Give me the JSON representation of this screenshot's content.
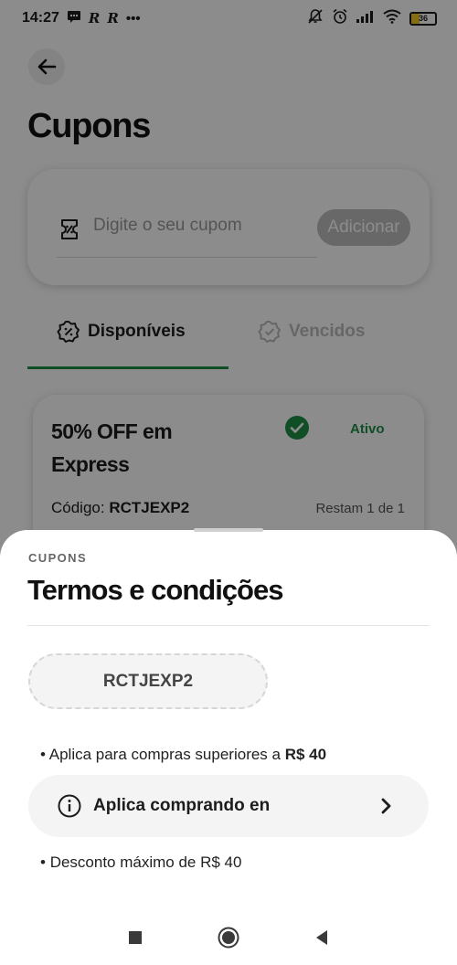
{
  "status_bar": {
    "time": "14:27",
    "left_icons": [
      "message-icon",
      "r-app-icon",
      "r-app-icon",
      "more-dots-icon"
    ],
    "right_icons": [
      "mute-icon",
      "alarm-icon",
      "signal-icon",
      "wifi-icon",
      "battery-icon"
    ],
    "battery_level": "36",
    "battery_fraction": 0.36
  },
  "header": {
    "back_icon": "arrow-left-icon",
    "title": "Cupons"
  },
  "coupon_input": {
    "icon": "coupon-ticket-icon",
    "placeholder": "Digite o seu cupom",
    "add_label": "Adicionar"
  },
  "tabs": [
    {
      "label": "Disponíveis",
      "icon": "badge-percent-icon",
      "selected": true
    },
    {
      "label": "Vencidos",
      "icon": "badge-check-icon",
      "selected": false
    }
  ],
  "coupon_card": {
    "title": "50% OFF em Express",
    "status": "Ativo",
    "status_icon": "check-circle-icon",
    "code_label": "Código:",
    "code": "RCTJEXP2",
    "remaining": "Restam 1 de 1"
  },
  "sheet": {
    "kicker": "CUPONS",
    "title": "Termos e condições",
    "code": "RCTJEXP2",
    "bullet_min_prefix": "Aplica para compras superiores a ",
    "bullet_min_value": "R$ 40",
    "apply_row": {
      "icon": "info-icon",
      "label": "Aplica comprando en",
      "chevron": "chevron-right-icon"
    },
    "bullet_max": "Desconto máximo de R$ 40"
  },
  "nav_bar": {
    "items": [
      "recents-square-icon",
      "home-circle-icon",
      "back-triangle-icon"
    ]
  },
  "colors": {
    "accent_green": "#1e8e46",
    "overlay": "rgba(0,0,0,0.45)"
  }
}
